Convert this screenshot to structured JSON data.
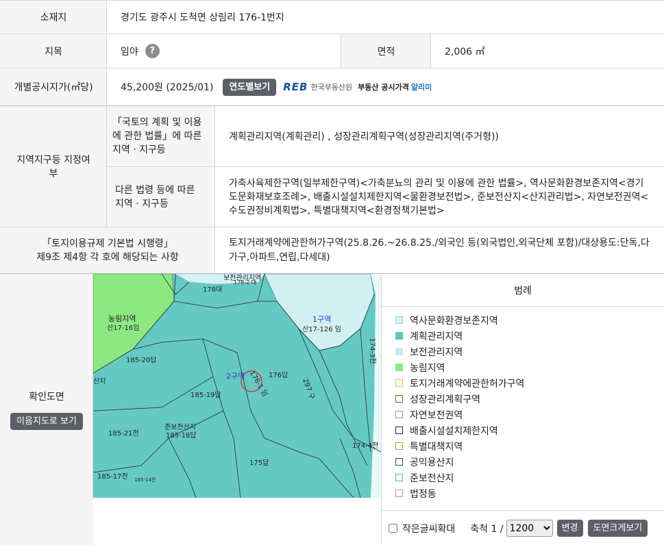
{
  "location": {
    "label": "소재지",
    "value": "경기도 광주시 도척면 상림리 176-1번지"
  },
  "land_category": {
    "label": "지목",
    "value": "임야",
    "help_icon": "?",
    "area_label": "면적",
    "area_value": "2,006 ㎡"
  },
  "price": {
    "label": "개별공시지가(㎡당)",
    "value": "45,200원 (2025/01)",
    "yearly_button": "연도별보기",
    "reb_logo": "REB",
    "reb_org": "한국부동산원",
    "reb_service": "부동산 공시가격",
    "reb_alert": "알리미"
  },
  "zoning": {
    "label": "지역지구등 지정여부",
    "national_label": "「국토의 계획 및 이용\n에 관한 법률」에 따른\n지역 · 지구등",
    "national_value": "계획관리지역(계획관리) , 성장관리계획구역(성장관리지역(주거형))",
    "other_label": "다른 법령 등에 따른\n지역 · 지구등",
    "other_value": "가축사육제한구역(일부제한구역)<가축분뇨의 관리 및 이용에 관한 법률>, 역사문화환경보존지역<경기도문화재보호조례>, 배출시설설치제한지역<물환경보전법>, 준보전산지<산지관리법>, 자연보전권역<수도권정비계획법>, 특별대책지역<환경정책기본법>"
  },
  "regulation": {
    "label": "「토지이용규제 기본법 시행령」\n제9조 제4항 각 호에 해당되는 사항",
    "value": "토지거래계약에관한허가구역(25.8.26.~26.8.25./외국인 등(외국법인,외국단체 포함)/대상용도:단독,다가구,아파트,연립,다세대)"
  },
  "map_section": {
    "label": "확인도면",
    "map_button": "이음지도로 보기",
    "legend_title": "범례",
    "legend": [
      {
        "label": "역사문화환경보존지역",
        "color": "#d8f4f0",
        "border": "#8fd6cc"
      },
      {
        "label": "계획관리지역",
        "color": "#5bc4be",
        "border": "#5bc4be"
      },
      {
        "label": "보전관리지역",
        "color": "#c8ecec",
        "border": "#c8ecec"
      },
      {
        "label": "농림지역",
        "color": "#8ee882",
        "border": "#8ee882"
      },
      {
        "label": "토지거래계약에관한허가구역",
        "color": "#ffffff",
        "border": "#e0c040"
      },
      {
        "label": "성장관리계획구역",
        "color": "#ffffff",
        "border": "#8a5a2a"
      },
      {
        "label": "자연보전권역",
        "color": "#ffffff",
        "border": "#999999"
      },
      {
        "label": "배출시설설치제한지역",
        "color": "#ffffff",
        "border": "#1a1a7a"
      },
      {
        "label": "특별대책지역",
        "color": "#ffffff",
        "border": "#b0a020"
      },
      {
        "label": "공익용산지",
        "color": "#ffffff",
        "border": "#1a5a3a"
      },
      {
        "label": "준보전산지",
        "color": "#ffffff",
        "border": "#4cb8a8"
      },
      {
        "label": "법정동",
        "color": "#ffffff",
        "border": "#b89a80"
      }
    ],
    "small_font_label": "작은글씨확대",
    "scale_label": "축척 1 /",
    "scale_value": "1200",
    "scale_options": [
      "1200"
    ],
    "change_button": "변경",
    "enlarge_button": "도면크게보기",
    "map_labels": {
      "top": "보전관리지역",
      "top_sub": "178-2 대",
      "p178": "178대",
      "nongrim": "농림지역",
      "nongrim_sub": "산17-16임",
      "zone1": "1구역",
      "zone1_sub": "산17-126 임",
      "p174_3": "174-3전",
      "p185_20": "185-20답",
      "zone2": "2구역",
      "p176_1": "176-1 임",
      "p176": "176답",
      "p297": "297 구",
      "p185_19": "185-19답",
      "left_frag": "산지",
      "p185_21": "185-21전",
      "junbo": "준보전산지",
      "p185_18": "185-18답",
      "p174_4": "174-4전",
      "p175": "175답",
      "p185_17": "185-17전",
      "p185_small": "185-14전"
    }
  }
}
